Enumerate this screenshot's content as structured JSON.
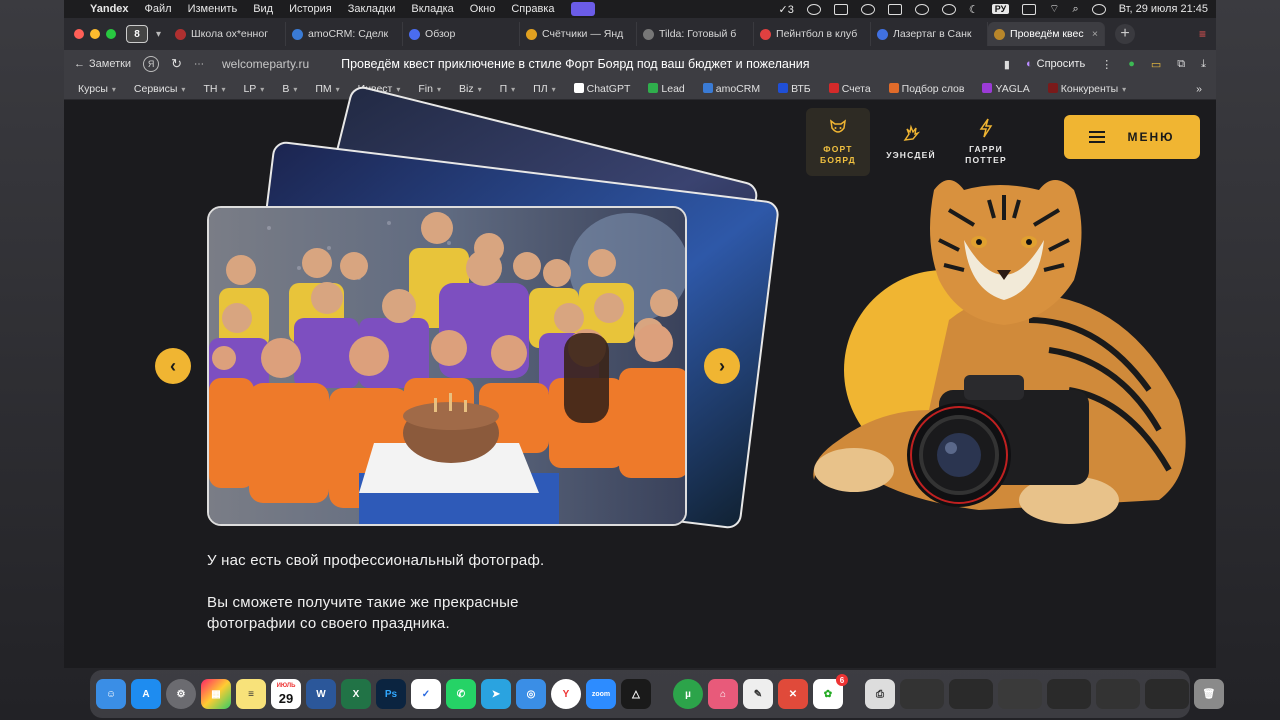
{
  "menubar": {
    "app": "Yandex",
    "items": [
      "Файл",
      "Изменить",
      "Вид",
      "История",
      "Закладки",
      "Вкладка",
      "Окно",
      "Справка"
    ],
    "badge": "3",
    "lang": "РУ",
    "datetime": "Вт, 29 июля  21:45"
  },
  "tabs": {
    "count": "8",
    "items": [
      {
        "label": "Школа ох*енног",
        "color": "#b03030"
      },
      {
        "label": "amoCRM: Сделк",
        "color": "#3a7bd5"
      },
      {
        "label": "Обзор",
        "color": "#4a6cf0"
      },
      {
        "label": "Счётчики — Янд",
        "color": "#e0a020"
      },
      {
        "label": "Tilda: Готовый б",
        "color": "#777777"
      },
      {
        "label": "Пейнтбол в клуб",
        "color": "#e04040"
      },
      {
        "label": "Лазертаг в Санк",
        "color": "#4070e0"
      },
      {
        "label": "Проведём квес",
        "color": "#b8862a"
      }
    ]
  },
  "address": {
    "back_label": "Заметки",
    "url": "welcomeparty.ru",
    "title": "Проведём квест приключение в стиле Форт Боярд под ваш бюджет и пожелания",
    "ask_label": "Спросить"
  },
  "bookmarks": [
    {
      "label": "Курсы",
      "chev": true
    },
    {
      "label": "Сервисы",
      "chev": true
    },
    {
      "label": "ТН",
      "chev": true
    },
    {
      "label": "LP",
      "chev": true
    },
    {
      "label": "В",
      "chev": true
    },
    {
      "label": "ПМ",
      "chev": true
    },
    {
      "label": "Инвест",
      "chev": true
    },
    {
      "label": "Fin",
      "chev": true
    },
    {
      "label": "Biz",
      "chev": true
    },
    {
      "label": "П",
      "chev": true
    },
    {
      "label": "ПЛ",
      "chev": true
    },
    {
      "label": "ChatGPT",
      "chev": false,
      "color": "#ffffff"
    },
    {
      "label": "Lead",
      "chev": false,
      "color": "#2fae4c"
    },
    {
      "label": "amoCRM",
      "chev": false,
      "color": "#3a7bd5"
    },
    {
      "label": "ВТБ",
      "chev": false,
      "color": "#1f4fd6"
    },
    {
      "label": "Счета",
      "chev": false,
      "color": "#d42a2a"
    },
    {
      "label": "Подбор слов",
      "chev": false,
      "color": "#e06b2a"
    },
    {
      "label": "YAGLA",
      "chev": false,
      "color": "#9b3bd6"
    },
    {
      "label": "Конкуренты",
      "chev": true,
      "color": "#7a1a1a"
    }
  ],
  "site": {
    "nav": [
      {
        "label1": "ФОРТ",
        "label2": "БОЯРД",
        "active": true,
        "icon": "tiger-icon"
      },
      {
        "label1": "УЭНСДЕЙ",
        "label2": "",
        "active": false,
        "icon": "hand-icon"
      },
      {
        "label1": "ГАРРИ",
        "label2": "ПОТТЕР",
        "active": false,
        "icon": "lightning-icon"
      }
    ],
    "menu_label": "МЕНЮ",
    "caption_line1": "У нас есть свой профессиональный фотограф.",
    "caption_line2": "Вы сможете получите такие же прекрасные",
    "caption_line3": "фотографии со своего праздника.",
    "accent": "#f0b532"
  },
  "dock": {
    "calendar_month": "ИЮЛЬ",
    "calendar_day": "29",
    "badge": "6"
  }
}
